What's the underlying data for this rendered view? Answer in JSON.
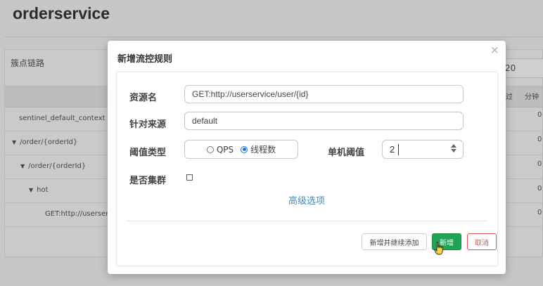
{
  "page": {
    "title": "orderservice",
    "panel_label": "簇点链路",
    "right_input_value": "20",
    "column_headers": [
      "过",
      "分钟"
    ],
    "rows": [
      {
        "label": "sentinel_default_context",
        "indent": 0,
        "expand": false,
        "value": "0"
      },
      {
        "label": "/order/{orderId}",
        "indent": 0,
        "expand": true,
        "value": "0"
      },
      {
        "label": "/order/{orderId}",
        "indent": 1,
        "expand": true,
        "value": "0"
      },
      {
        "label": "hot",
        "indent": 2,
        "expand": true,
        "value": "0"
      },
      {
        "label": "GET:http://userservic",
        "indent": 3,
        "expand": false,
        "value": "0"
      }
    ]
  },
  "modal": {
    "title": "新增流控规则",
    "close_icon": "×",
    "resource": {
      "label": "资源名",
      "value": "GET:http://userservice/user/{id}"
    },
    "source": {
      "label": "针对来源",
      "value": "default"
    },
    "threshold_type": {
      "label": "阈值类型",
      "options": [
        "QPS",
        "线程数"
      ],
      "selected": "线程数"
    },
    "threshold": {
      "label": "单机阈值",
      "value": "2"
    },
    "cluster": {
      "label": "是否集群",
      "checked": false
    },
    "advanced_link": "高级选项",
    "buttons": {
      "add_continue": "新增并继续添加",
      "add": "新增",
      "cancel": "取消"
    }
  },
  "colors": {
    "primary": "#21a457",
    "danger": "#d9534f",
    "link": "#3c8dbc",
    "radio": "#1a73e8"
  }
}
